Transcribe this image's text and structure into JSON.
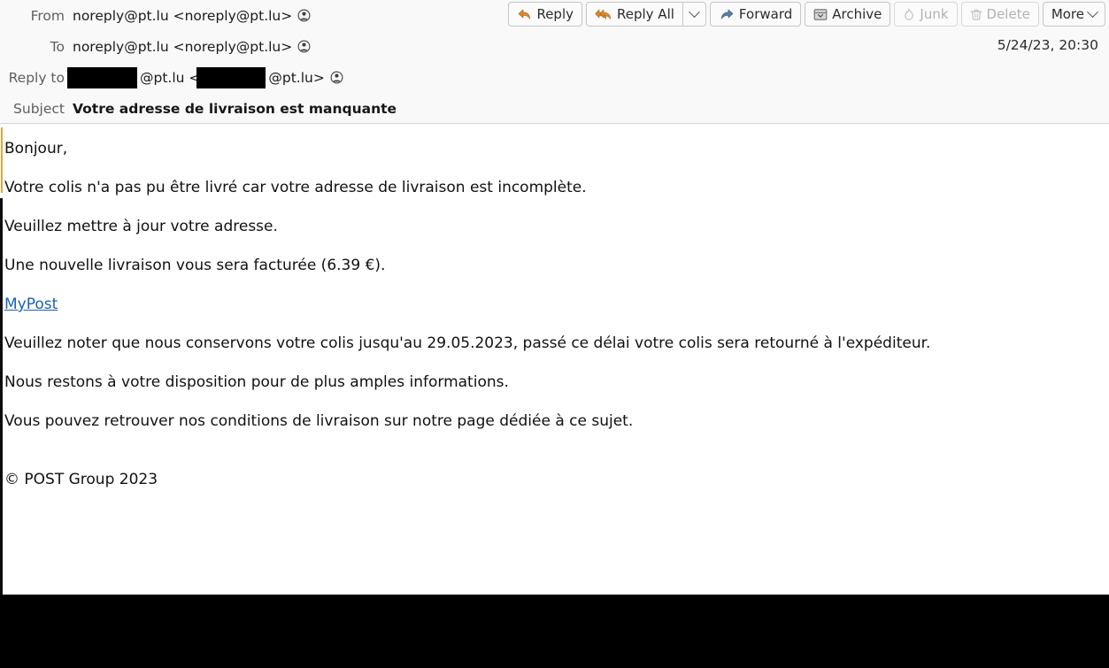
{
  "toolbar": {
    "buttons": [
      {
        "label": "Reply",
        "icon": "reply-arrow-icon",
        "disabled": false,
        "has_caret": false
      },
      {
        "label": "Reply All",
        "icon": "reply-all-arrow-icon",
        "disabled": false,
        "has_caret": true
      },
      {
        "label": "Forward",
        "icon": "forward-arrow-icon",
        "disabled": false,
        "has_caret": false
      },
      {
        "label": "Archive",
        "icon": "archive-box-icon",
        "disabled": false,
        "has_caret": false
      },
      {
        "label": "Junk",
        "icon": "junk-flame-icon",
        "disabled": true,
        "has_caret": false
      },
      {
        "label": "Delete",
        "icon": "delete-trash-icon",
        "disabled": true,
        "has_caret": false
      },
      {
        "label": "More",
        "icon": "",
        "disabled": false,
        "has_caret": true
      }
    ]
  },
  "header": {
    "rows": {
      "from": {
        "label": "From",
        "value": "noreply@pt.lu <noreply@pt.lu>"
      },
      "to": {
        "label": "To",
        "value": "noreply@pt.lu <noreply@pt.lu>"
      },
      "reply_to": {
        "label": "Reply to",
        "redacted_1": "",
        "mid_text": "@pt.lu <",
        "redacted_2": "",
        "tail_text": "@pt.lu>"
      },
      "subject": {
        "label": "Subject",
        "value": "Votre adresse de livraison est manquante"
      }
    },
    "date": "5/24/23, 20:30"
  },
  "body": {
    "paragraphs": [
      "Bonjour,",
      "Votre colis n'a pas pu être livré car votre adresse de livraison est incomplète.",
      "Veuillez mettre à jour votre adresse.",
      "Une nouvelle livraison vous sera facturée (6.39 €)."
    ],
    "link_label": "MyPost",
    "paragraphs_after": [
      "Veuillez noter que nous conservons votre colis jusqu'au 29.05.2023, passé ce délai votre colis sera retourné à l'expéditeur.",
      "Nous restons à votre disposition pour de plus amples informations.",
      "Vous pouvez retrouver nos conditions de livraison sur notre page dédiée à ce sujet."
    ],
    "footer": "© POST Group 2023"
  },
  "colors": {
    "link": "#1a5fb4",
    "quote_amber": "#e8a33d",
    "quote_dark": "#0b0b0b",
    "header_bg": "#f9f9f9",
    "reply_icon": "#d98b2b"
  }
}
